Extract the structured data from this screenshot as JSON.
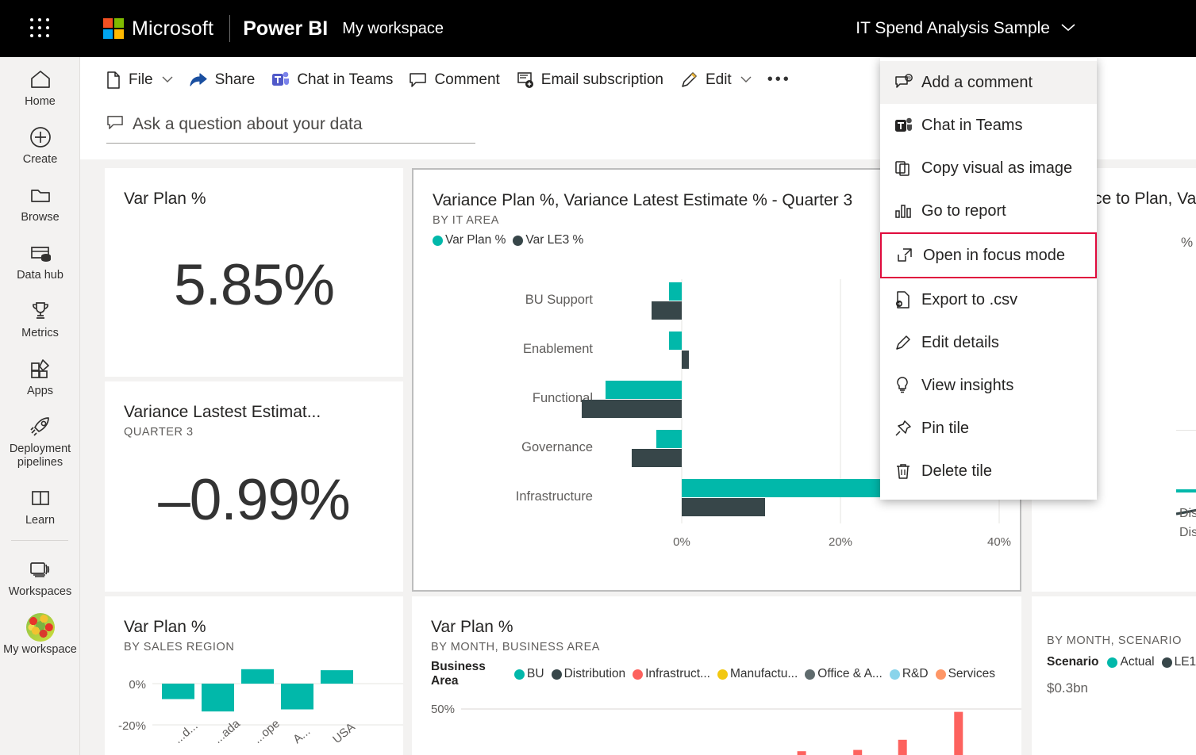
{
  "topbar": {
    "waffle_label": "app-launcher",
    "microsoft": "Microsoft",
    "product": "Power BI",
    "workspace": "My workspace",
    "report_name": "IT Spend Analysis Sample",
    "report_chevron": "⌄"
  },
  "rail": {
    "items": [
      {
        "label": "Home",
        "icon": "home-icon"
      },
      {
        "label": "Create",
        "icon": "plus-circle-icon"
      },
      {
        "label": "Browse",
        "icon": "folder-icon"
      },
      {
        "label": "Data hub",
        "icon": "data-hub-icon"
      },
      {
        "label": "Metrics",
        "icon": "trophy-icon"
      },
      {
        "label": "Apps",
        "icon": "apps-icon"
      },
      {
        "label": "Deployment pipelines",
        "icon": "rocket-icon"
      },
      {
        "label": "Learn",
        "icon": "book-icon"
      },
      {
        "label": "Workspaces",
        "icon": "workspaces-icon"
      },
      {
        "label": "My workspace",
        "icon": "avatar"
      }
    ]
  },
  "commandbar": {
    "items": [
      {
        "label": "File",
        "icon": "file-icon",
        "chevron": "⌄"
      },
      {
        "label": "Share",
        "icon": "share-icon",
        "chevron": ""
      },
      {
        "label": "Chat in Teams",
        "icon": "teams-icon",
        "chevron": ""
      },
      {
        "label": "Comment",
        "icon": "comment-icon",
        "chevron": ""
      },
      {
        "label": "Email subscription",
        "icon": "email-subscription-icon",
        "chevron": ""
      },
      {
        "label": "Edit",
        "icon": "pencil-icon",
        "chevron": "⌄"
      },
      {
        "label": "•••",
        "icon": "more-icon",
        "chevron": ""
      }
    ]
  },
  "qna": {
    "placeholder": "Ask a question about your data",
    "icon": "qna-comment-icon"
  },
  "tiles": {
    "varplan_card": {
      "title": "Var Plan %",
      "value": "5.85%"
    },
    "variance_le_card": {
      "title": "Variance Lastest Estimat...",
      "subtitle": "QUARTER 3",
      "value": "–0.99%"
    },
    "sales_region": {
      "title": "Var Plan %",
      "subtitle": "BY SALES REGION"
    },
    "main_chart": {
      "title": "Variance Plan %, Variance Latest Estimate % - Quarter 3",
      "subtitle": "BY IT AREA",
      "more_button": "•••"
    },
    "month_business_area": {
      "title": "Var Plan %",
      "subtitle": "BY MONTH, BUSINESS AREA",
      "legend_title": "Business Area"
    },
    "variance_to_plan": {
      "title": "Variance to Plan, Va",
      "clipped_value": "%"
    },
    "month_scenario": {
      "subtitle": "BY MONTH, SCENARIO",
      "legend_title": "Scenario",
      "axis_label": "$0.3bn",
      "clipped_labels": [
        "Dist",
        "Dist"
      ]
    }
  },
  "context_menu": {
    "items": [
      {
        "label": "Add a comment",
        "icon": "add-comment-icon",
        "state": "hovered"
      },
      {
        "label": "Chat in Teams",
        "icon": "teams-icon",
        "state": "normal"
      },
      {
        "label": "Copy visual as image",
        "icon": "copy-icon",
        "state": "normal"
      },
      {
        "label": "Go to report",
        "icon": "bar-chart-icon",
        "state": "normal"
      },
      {
        "label": "Open in focus mode",
        "icon": "focus-mode-icon",
        "state": "highlight"
      },
      {
        "label": "Export to .csv",
        "icon": "export-csv-icon",
        "state": "normal"
      },
      {
        "label": "Edit details",
        "icon": "pencil-icon",
        "state": "normal"
      },
      {
        "label": "View insights",
        "icon": "lightbulb-icon",
        "state": "normal"
      },
      {
        "label": "Pin tile",
        "icon": "pin-icon",
        "state": "normal"
      },
      {
        "label": "Delete tile",
        "icon": "trash-icon",
        "state": "normal"
      }
    ]
  },
  "colors": {
    "teal": "#01b8aa",
    "dark": "#374649",
    "red_highlight": "#e00b3d",
    "red_series": "#fd625e",
    "yellow": "#f2c811",
    "gray": "#5f6b6d",
    "lightblue": "#8ad4eb",
    "orange": "#fe9666",
    "black": "#000000"
  },
  "chart_data": [
    {
      "type": "bar",
      "orientation": "horizontal",
      "title": "Variance Plan %, Variance Latest Estimate % - Quarter 3",
      "subtitle": "BY IT AREA",
      "xlabel": "",
      "ylabel": "",
      "categories": [
        "BU Support",
        "Enablement",
        "Functional",
        "Governance",
        "Infrastructure"
      ],
      "series": [
        {
          "name": "Var Plan %",
          "color": "#01b8aa",
          "values": [
            -1.6,
            -1.6,
            -9.6,
            -3.2,
            46.0
          ]
        },
        {
          "name": "Var LE3 %",
          "color": "#374649",
          "values": [
            -3.8,
            0.9,
            -12.6,
            -6.3,
            10.5
          ]
        }
      ],
      "xticks": [
        "0%",
        "20%",
        "40%"
      ],
      "xtick_values": [
        0,
        20,
        40
      ],
      "xlim": [
        -14,
        48
      ],
      "grid": true,
      "legend": [
        "Var Plan %",
        "Var LE3 %"
      ],
      "legend_position": "top"
    },
    {
      "type": "bar",
      "orientation": "vertical",
      "title": "Var Plan %",
      "subtitle": "BY SALES REGION",
      "categories": [
        "...d...",
        "...ada",
        "...ope",
        "A...",
        "USA"
      ],
      "values": [
        -7.5,
        -13.5,
        7.0,
        -12.5,
        6.5
      ],
      "yticks": [
        "0%",
        "-20%"
      ],
      "ytick_values": [
        0,
        -20
      ],
      "ylim": [
        -22,
        12
      ],
      "series": [
        {
          "name": "Var Plan %",
          "color": "#01b8aa"
        }
      ]
    },
    {
      "type": "bar",
      "orientation": "vertical",
      "title": "Var Plan %",
      "subtitle": "BY MONTH, BUSINESS AREA",
      "legend_title": "Business Area",
      "legend": [
        {
          "name": "BU",
          "color": "#01b8aa"
        },
        {
          "name": "Distribution",
          "color": "#374649"
        },
        {
          "name": "Infrastruct...",
          "color": "#fd625e"
        },
        {
          "name": "Manufactu...",
          "color": "#f2c811"
        },
        {
          "name": "Office & A...",
          "color": "#5f6b6d"
        },
        {
          "name": "R&D",
          "color": "#8ad4eb"
        },
        {
          "name": "Services",
          "color": "#fe9666"
        }
      ],
      "yticks": [
        "50%"
      ],
      "ytick_values": [
        50
      ],
      "visible_bars": [
        {
          "x": 0.6,
          "color": "#fd625e",
          "height": 3
        },
        {
          "x": 0.7,
          "color": "#fd625e",
          "height": 4
        },
        {
          "x": 0.78,
          "color": "#fd625e",
          "height": 12
        },
        {
          "x": 0.88,
          "color": "#fd625e",
          "height": 34
        }
      ]
    },
    {
      "type": "line",
      "title": "Variance to Plan, Va",
      "subtitle": "BY MONTH, SCENARIO",
      "legend_title": "Scenario",
      "legend": [
        {
          "name": "Actual",
          "color": "#01b8aa"
        },
        {
          "name": "LE1",
          "color": "#374649"
        }
      ],
      "yticks": [
        "$0.3bn"
      ]
    }
  ]
}
